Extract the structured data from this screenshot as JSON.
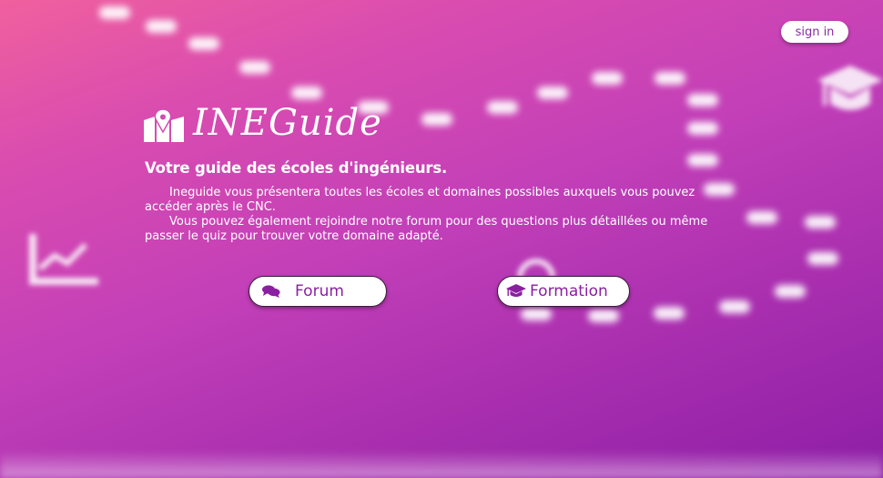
{
  "header": {
    "signin_label": "sign in"
  },
  "brand": {
    "title": "INEGuide",
    "icon": "map-pin-icon"
  },
  "hero": {
    "tagline": "Votre guide des écoles d'ingénieurs.",
    "paragraph1": "Ineguide vous présentera toutes les écoles et domaines possibles auxquels vous pouvez accéder après le CNC.",
    "paragraph2": "Vous pouvez également rejoindre notre forum pour des questions plus détaillées ou même passer le quiz pour trouver votre domaine adapté."
  },
  "actions": {
    "forum_label": "Forum",
    "forum_icon": "comments-icon",
    "formation_label": "Formation",
    "formation_icon": "graduation-cap-icon"
  },
  "colors": {
    "gradient_start": "#f0609e",
    "gradient_end": "#8e1ea6",
    "accent_text": "#8a1fa0",
    "button_bg": "#ffffff"
  }
}
